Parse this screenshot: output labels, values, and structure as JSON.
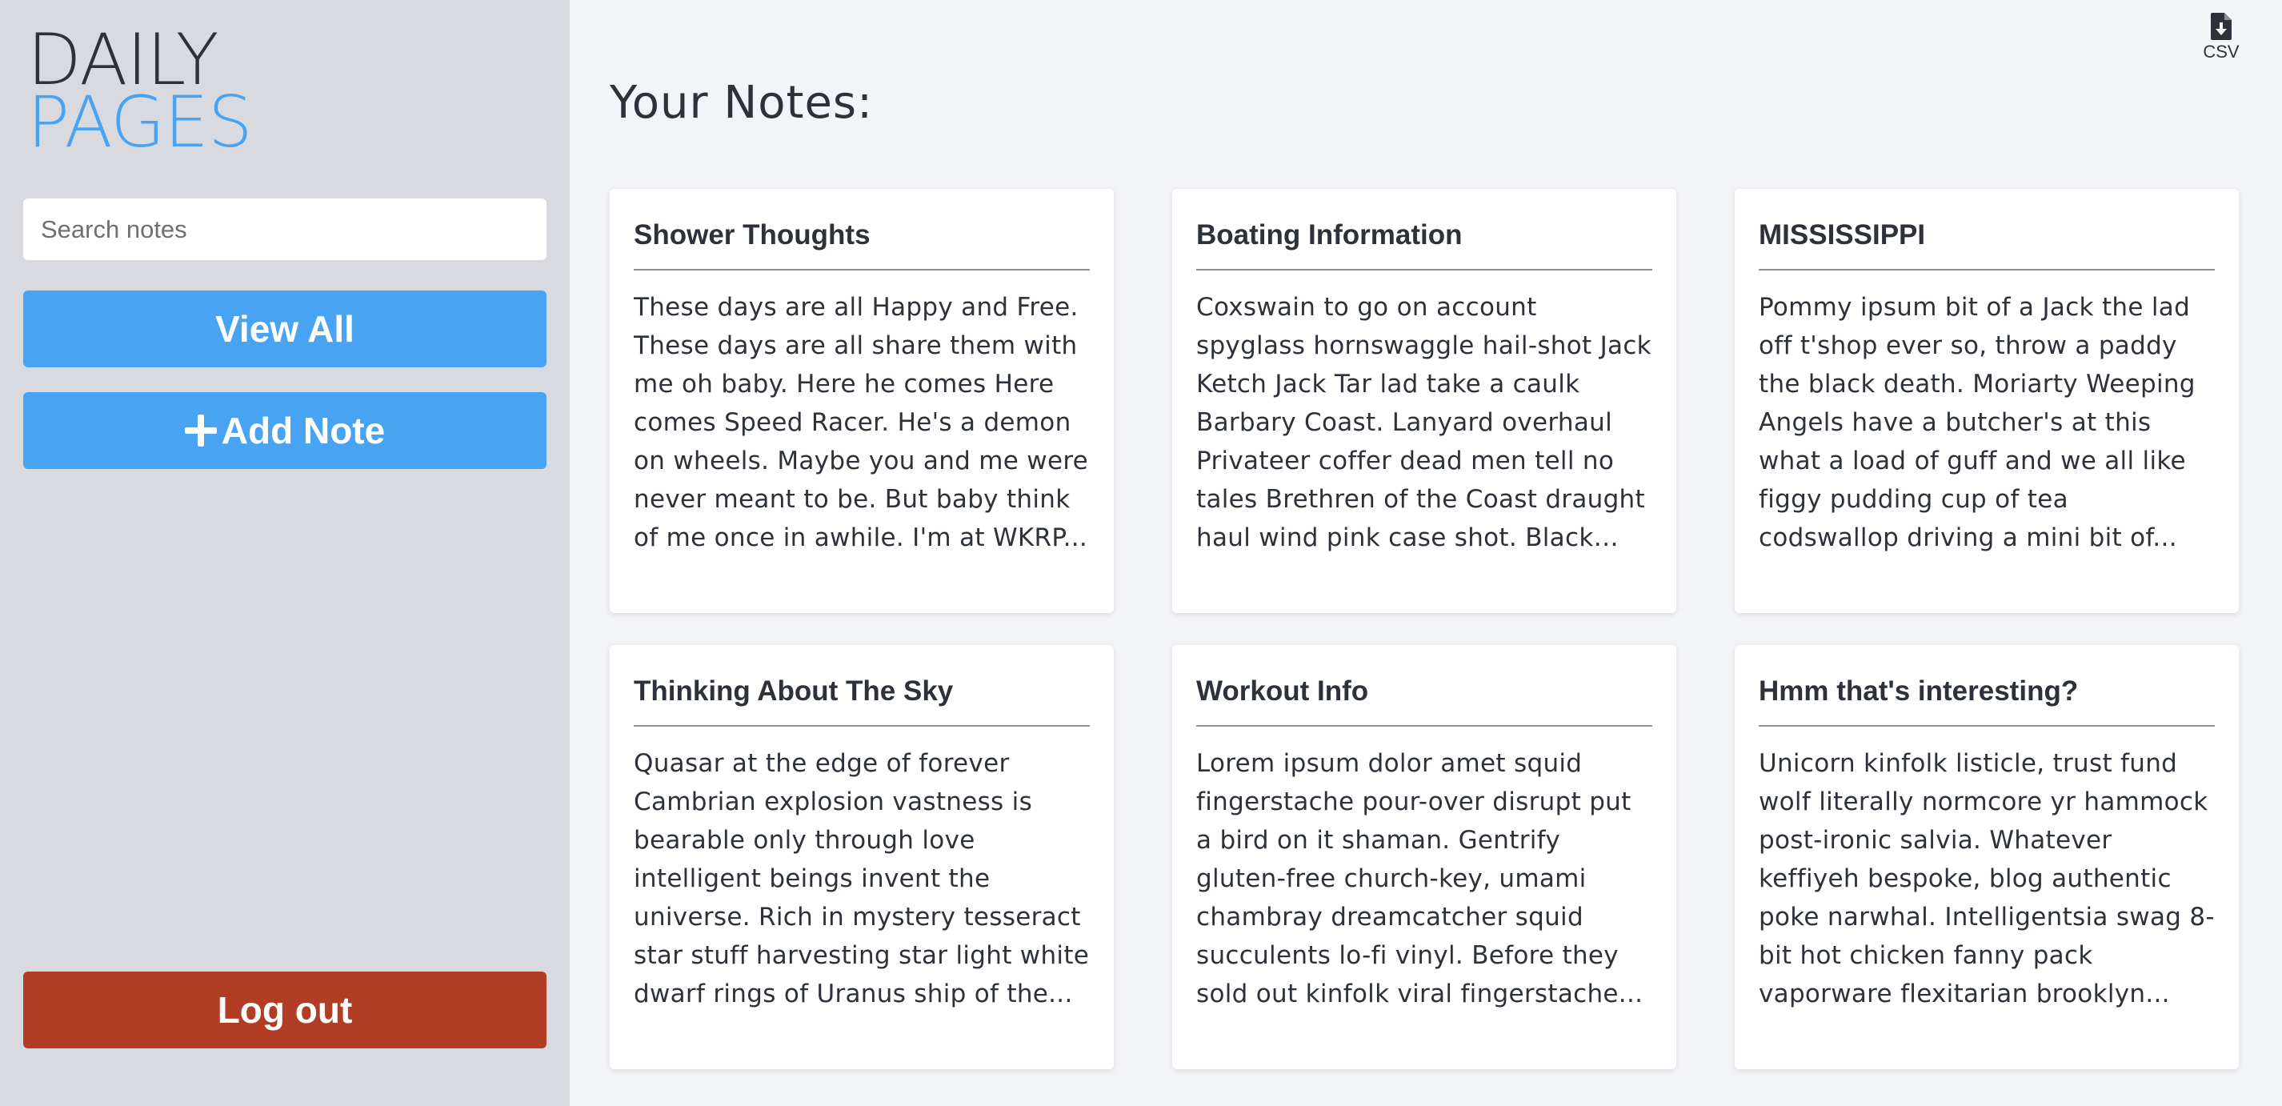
{
  "sidebar": {
    "logo_line1": "DAILY",
    "logo_line2": "PAGES",
    "search_placeholder": "Search notes",
    "view_all_label": "View All",
    "add_note_label": "Add Note",
    "logout_label": "Log out"
  },
  "main": {
    "title": "Your Notes:",
    "export_label": "CSV",
    "notes": [
      {
        "title": "Shower Thoughts",
        "body": "These days are all Happy and Free. These days are all share them with me oh baby. Here he comes Here comes Speed Racer. He's a demon on wheels. Maybe you and me were never meant to be. But baby think of me once in awhile. I'm at WKRP..."
      },
      {
        "title": "Boating Information",
        "body": "Coxswain to go on account spyglass hornswaggle hail-shot Jack Ketch Jack Tar lad take a caulk Barbary Coast. Lanyard overhaul Privateer coffer dead men tell no tales Brethren of the Coast draught haul wind pink case shot. Black spot..."
      },
      {
        "title": "MISSISSIPPI",
        "body": "Pommy ipsum bit of a Jack the lad off t'shop ever so, throw a paddy the black death. Moriarty Weeping Angels have a butcher's at this what a load of guff and we all like figgy pudding cup of tea codswallop driving a mini bit of..."
      },
      {
        "title": "Thinking About The Sky",
        "body": "Quasar at the edge of forever Cambrian explosion vastness is bearable only through love intelligent beings invent the universe. Rich in mystery tesseract star stuff harvesting star light white dwarf rings of Uranus ship of the..."
      },
      {
        "title": "Workout Info",
        "body": "Lorem ipsum dolor amet squid fingerstache pour-over disrupt put a bird on it shaman. Gentrify gluten-free church-key, umami chambray dreamcatcher squid succulents lo-fi vinyl. Before they sold out kinfolk viral fingerstache..."
      },
      {
        "title": "Hmm that's interesting?",
        "body": "Unicorn kinfolk listicle, trust fund wolf literally normcore yr hammock post-ironic salvia. Whatever keffiyeh bespoke, blog authentic poke narwhal. Intelligentsia swag 8-bit hot chicken fanny pack vaporware flexitarian brooklyn..."
      }
    ]
  },
  "colors": {
    "sidebar_bg": "#d8dadf",
    "main_bg": "#f3f4f8",
    "accent_blue": "#48a4f2",
    "logout_red": "#b13d25",
    "text_dark": "#2d3139"
  },
  "icons": {
    "add": "plus-icon",
    "export": "file-download-icon"
  }
}
